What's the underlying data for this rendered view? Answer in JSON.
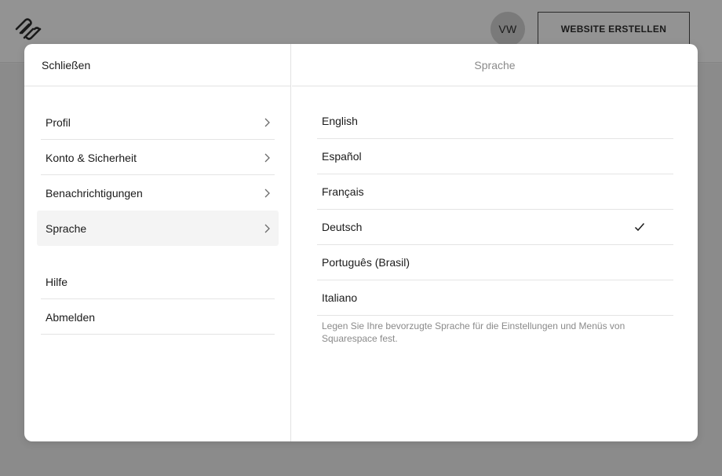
{
  "header": {
    "logo_icon": "squarespace-logo-icon",
    "avatar_initials": "VW",
    "create_website_label": "WEBSITE ERSTELLEN"
  },
  "modal": {
    "close_label": "Schließen",
    "panel_title": "Sprache",
    "menu_primary": [
      {
        "label": "Profil",
        "icon": "chevron-right-icon"
      },
      {
        "label": "Konto & Sicherheit",
        "icon": "chevron-right-icon"
      },
      {
        "label": "Benachrichtigungen",
        "icon": "chevron-right-icon"
      },
      {
        "label": "Sprache",
        "icon": "chevron-right-icon",
        "active": true
      }
    ],
    "menu_secondary": [
      {
        "label": "Hilfe"
      },
      {
        "label": "Abmelden"
      }
    ],
    "languages": [
      {
        "label": "English"
      },
      {
        "label": "Español"
      },
      {
        "label": "Français"
      },
      {
        "label": "Deutsch",
        "selected": true
      },
      {
        "label": "Português (Brasil)"
      },
      {
        "label": "Italiano"
      }
    ],
    "language_hint": "Legen Sie Ihre bevorzugte Sprache für die Einstellungen und Menüs von Squarespace fest."
  },
  "colors": {
    "overlay": "#8e8e8e",
    "modal_bg": "#ffffff",
    "active_item_bg": "#f4f4f4",
    "divider": "#e4e4e4",
    "muted_text": "#8a8a8a"
  }
}
